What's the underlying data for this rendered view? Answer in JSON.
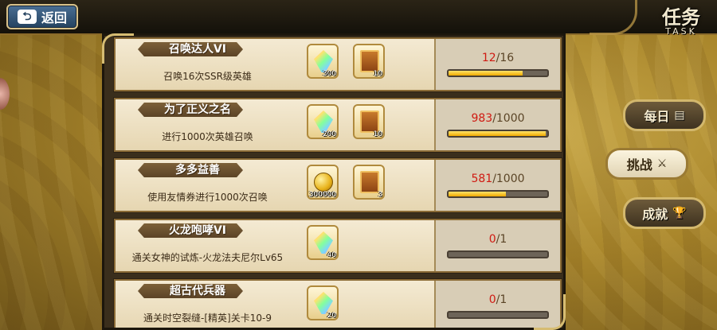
{
  "header": {
    "back_label": "返回",
    "back_icon": "return-arrow-icon",
    "title": "任务",
    "title_en": "TASK"
  },
  "tabs": [
    {
      "label": "每日",
      "icon": "scroll-icon",
      "active": false
    },
    {
      "label": "挑战",
      "icon": "crossed-swords-icon",
      "active": true
    },
    {
      "label": "成就",
      "icon": "trophy-icon",
      "active": false
    }
  ],
  "tasks": [
    {
      "name": "召唤达人VI",
      "desc": "召唤16次SSR级英雄",
      "rewards": [
        {
          "type": "crystal",
          "qty": "300"
        },
        {
          "type": "ticket",
          "qty": "10"
        }
      ],
      "current": "12",
      "total": "/16",
      "progress": 0.75
    },
    {
      "name": "为了正义之名",
      "desc": "进行1000次英雄召唤",
      "rewards": [
        {
          "type": "crystal",
          "qty": "200"
        },
        {
          "type": "ticket",
          "qty": "10"
        }
      ],
      "current": "983",
      "total": "/1000",
      "progress": 0.983
    },
    {
      "name": "多多益善",
      "desc": "使用友情券进行1000次召唤",
      "rewards": [
        {
          "type": "coin",
          "qty": "300000"
        },
        {
          "type": "ticket",
          "qty": "3"
        }
      ],
      "current": "581",
      "total": "/1000",
      "progress": 0.581
    },
    {
      "name": "火龙咆哮VI",
      "desc": "通关女神的试炼-火龙法夫尼尔Lv65",
      "rewards": [
        {
          "type": "crystal",
          "qty": "40"
        }
      ],
      "current": "0",
      "total": "/1",
      "progress": 0
    },
    {
      "name": "超古代兵器",
      "desc": "通关时空裂缝-[精英]关卡10-9",
      "rewards": [
        {
          "type": "crystal",
          "qty": "20"
        }
      ],
      "current": "0",
      "total": "/1",
      "progress": 0
    }
  ]
}
